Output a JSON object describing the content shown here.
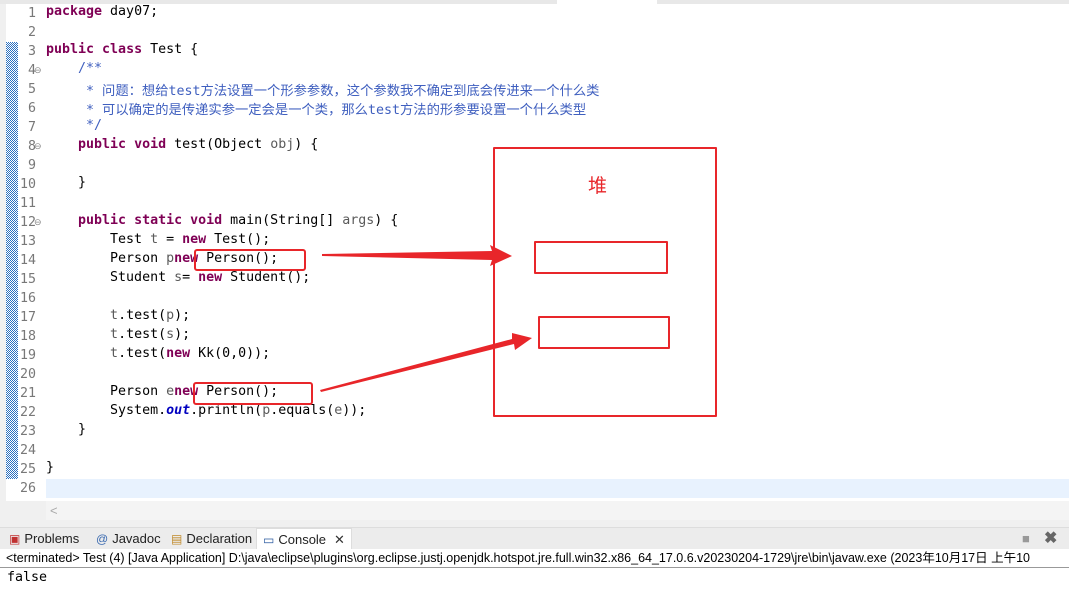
{
  "editor": {
    "lines": [
      [
        [
          "kw",
          "package"
        ],
        [
          "",
          "day07;"
        ]
      ],
      [],
      [
        [
          "kw",
          "public"
        ],
        [
          "",
          ""
        ],
        [
          "kw",
          "class"
        ],
        [
          "",
          "Test {"
        ]
      ],
      [
        [
          "",
          "    "
        ],
        [
          "cm",
          "/**"
        ]
      ],
      [
        [
          "cm",
          "     * 问题：想给test方法设置一个形参参数，这个参数我不确定到底会传进来一个什么类"
        ]
      ],
      [
        [
          "cm",
          "     * 可以确定的是传递实参一定会是一个类，那么test方法的形参要设置一个什么类型"
        ]
      ],
      [
        [
          "cm",
          "     */"
        ]
      ],
      [
        [
          "",
          "    "
        ],
        [
          "kw",
          "public"
        ],
        [
          "",
          ""
        ],
        [
          "kw",
          "void"
        ],
        [
          "",
          "test(Object "
        ],
        [
          "lv",
          "obj"
        ],
        [
          "",
          ") {"
        ]
      ],
      [],
      [
        [
          "",
          "    }"
        ]
      ],
      [],
      [
        [
          "",
          "    "
        ],
        [
          "kw",
          "public"
        ],
        [
          "",
          ""
        ],
        [
          "kw",
          "static"
        ],
        [
          "",
          ""
        ],
        [
          "kw",
          "void"
        ],
        [
          "",
          "main(String[] "
        ],
        [
          "lv",
          "args"
        ],
        [
          "",
          ") {"
        ]
      ],
      [
        [
          "",
          "        Test "
        ],
        [
          "lv",
          "t"
        ],
        [
          "",
          " = "
        ],
        [
          "kw",
          "new"
        ],
        [
          "",
          "Test();"
        ]
      ],
      [
        [
          "",
          "        Person "
        ],
        [
          "lv",
          "p"
        ],
        [
          "",
          "",
          " = "
        ],
        [
          "kw",
          "new"
        ],
        [
          "",
          "Person();"
        ]
      ],
      [
        [
          "",
          "        Student "
        ],
        [
          "lv",
          "s"
        ],
        [
          "",
          "= "
        ],
        [
          "kw",
          "new"
        ],
        [
          "",
          "Student();"
        ]
      ],
      [],
      [
        [
          "",
          "        "
        ],
        [
          "lv",
          "t"
        ],
        [
          "",
          ".test("
        ],
        [
          "lv",
          "p"
        ],
        [
          "",
          ");"
        ]
      ],
      [
        [
          "",
          "        "
        ],
        [
          "lv",
          "t"
        ],
        [
          "",
          ".test("
        ],
        [
          "lv",
          "s"
        ],
        [
          "",
          ");"
        ]
      ],
      [
        [
          "",
          "        "
        ],
        [
          "lv",
          "t"
        ],
        [
          "",
          ".test("
        ],
        [
          "kw",
          "new"
        ],
        [
          "",
          "Kk(0,0));"
        ]
      ],
      [],
      [
        [
          "",
          "        Person "
        ],
        [
          "lv",
          "e"
        ],
        [
          "",
          "",
          " = "
        ],
        [
          "kw",
          "new"
        ],
        [
          "",
          "Person();"
        ]
      ],
      [
        [
          "",
          "        System."
        ],
        [
          "st",
          "out"
        ],
        [
          "",
          ".println("
        ],
        [
          "lv",
          "p"
        ],
        [
          "",
          ".equals("
        ],
        [
          "lv",
          "e"
        ],
        [
          "",
          "));"
        ]
      ],
      [
        [
          "",
          "    }"
        ]
      ],
      [],
      [
        [
          "",
          "}"
        ]
      ],
      []
    ],
    "folded_lines": [
      4,
      8,
      12
    ],
    "hscroll_arrow": "<"
  },
  "annotation": {
    "heap_label": "堆",
    "color": "#e8262a"
  },
  "panel": {
    "tabs": [
      {
        "label": "Problems",
        "icon": "problems-icon"
      },
      {
        "label": "Javadoc",
        "icon": "at-icon"
      },
      {
        "label": "Declaration",
        "icon": "declaration-icon"
      },
      {
        "label": "Console",
        "icon": "console-icon",
        "active": true
      }
    ],
    "console_header": "<terminated> Test (4) [Java Application] D:\\java\\eclipse\\plugins\\org.eclipse.justj.openjdk.hotspot.jre.full.win32.x86_64_17.0.6.v20230204-1729\\jre\\bin\\javaw.exe  (2023年10月17日 上午10",
    "output": "false"
  }
}
